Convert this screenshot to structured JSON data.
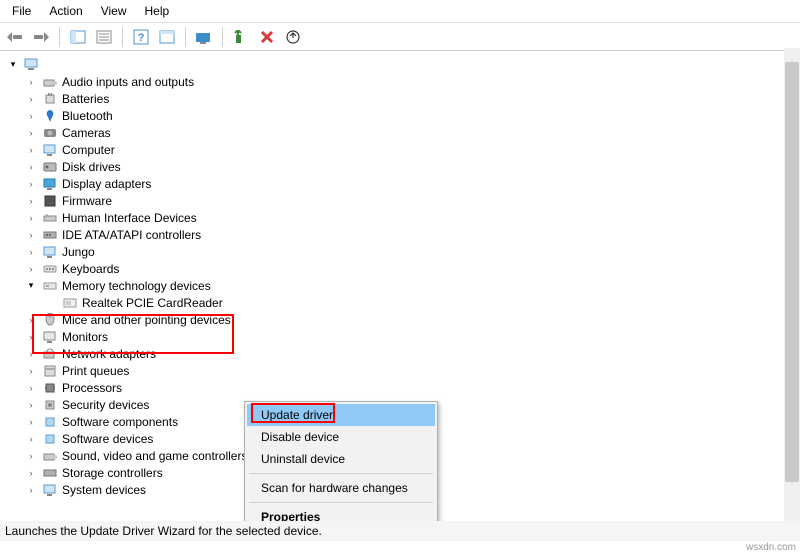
{
  "menu": {
    "file": "File",
    "action": "Action",
    "view": "View",
    "help": "Help"
  },
  "tree": {
    "items": [
      "Audio inputs and outputs",
      "Batteries",
      "Bluetooth",
      "Cameras",
      "Computer",
      "Disk drives",
      "Display adapters",
      "Firmware",
      "Human Interface Devices",
      "IDE ATA/ATAPI controllers",
      "Jungo",
      "Keyboards",
      "Memory technology devices",
      "Mice and other pointing devices",
      "Monitors",
      "Network adapters",
      "Print queues",
      "Processors",
      "Security devices",
      "Software components",
      "Software devices",
      "Sound, video and game controllers",
      "Storage controllers",
      "System devices"
    ],
    "memory_child": "Realtek PCIE CardReader"
  },
  "context_menu": {
    "update": "Update driver",
    "disable": "Disable device",
    "uninstall": "Uninstall device",
    "scan": "Scan for hardware changes",
    "properties": "Properties"
  },
  "statusbar": "Launches the Update Driver Wizard for the selected device.",
  "watermark": "wsxdn.com",
  "colors": {
    "highlight": "#ff0000",
    "selection": "#90c8f6"
  }
}
